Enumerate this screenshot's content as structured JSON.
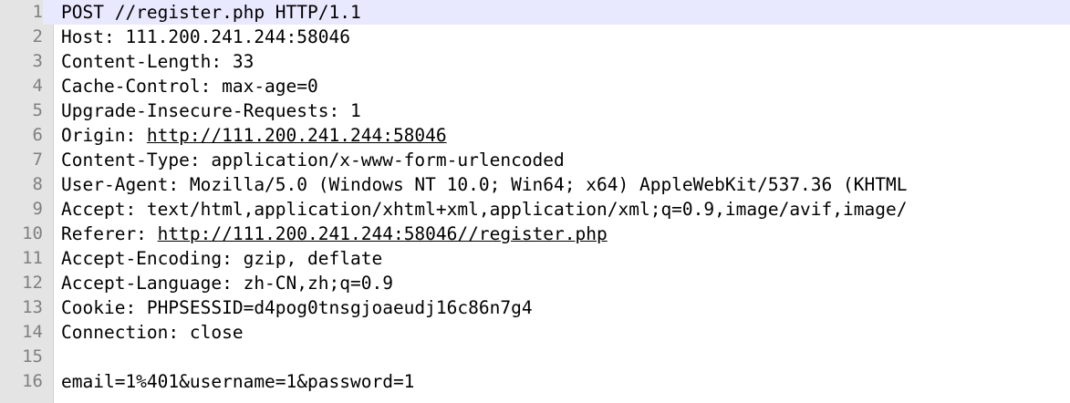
{
  "editor": {
    "lines": [
      {
        "num": "1",
        "text": "POST //register.php HTTP/1.1"
      },
      {
        "num": "2",
        "text": "Host: 111.200.241.244:58046"
      },
      {
        "num": "3",
        "text": "Content-Length: 33"
      },
      {
        "num": "4",
        "text": "Cache-Control: max-age=0"
      },
      {
        "num": "5",
        "text": "Upgrade-Insecure-Requests: 1"
      },
      {
        "num": "6",
        "prefix": "Origin: ",
        "link": "http://111.200.241.244:58046"
      },
      {
        "num": "7",
        "text": "Content-Type: application/x-www-form-urlencoded"
      },
      {
        "num": "8",
        "text": "User-Agent: Mozilla/5.0 (Windows NT 10.0; Win64; x64) AppleWebKit/537.36 (KHTML"
      },
      {
        "num": "9",
        "text": "Accept: text/html,application/xhtml+xml,application/xml;q=0.9,image/avif,image/"
      },
      {
        "num": "10",
        "prefix": "Referer: ",
        "link": "http://111.200.241.244:58046//register.php"
      },
      {
        "num": "11",
        "text": "Accept-Encoding: gzip, deflate"
      },
      {
        "num": "12",
        "text": "Accept-Language: zh-CN,zh;q=0.9"
      },
      {
        "num": "13",
        "text": "Cookie: PHPSESSID=d4pog0tnsgjoaeudj16c86n7g4"
      },
      {
        "num": "14",
        "text": "Connection: close"
      },
      {
        "num": "15",
        "text": ""
      },
      {
        "num": "16",
        "text": "email=1%401&username=1&password=1"
      }
    ]
  }
}
